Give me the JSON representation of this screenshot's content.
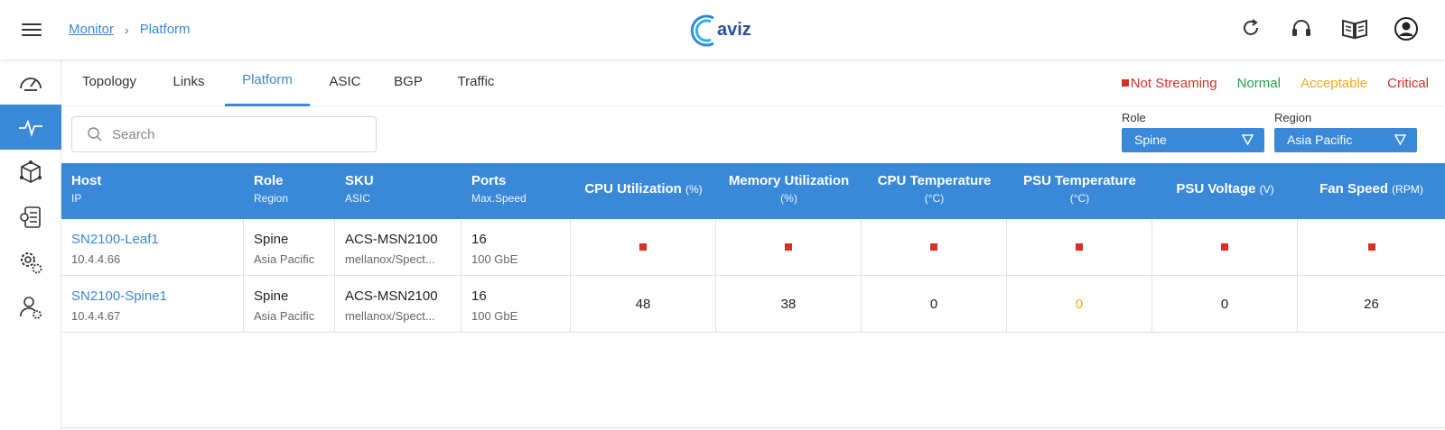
{
  "breadcrumb": {
    "root": "Monitor",
    "separator": "›",
    "current": "Platform"
  },
  "logo": {
    "text": "aviz"
  },
  "header_icons": [
    "refresh-icon",
    "headset-icon",
    "book-icon",
    "user-account-icon"
  ],
  "sidebar_icons": [
    "dashboard-gauge-icon",
    "monitor-pulse-icon",
    "network-cube-icon",
    "config-document-icon",
    "settings-gears-icon",
    "user-settings-icon"
  ],
  "tabs": [
    {
      "label": "Topology"
    },
    {
      "label": "Links"
    },
    {
      "label": "Platform",
      "active": true
    },
    {
      "label": "ASIC"
    },
    {
      "label": "BGP"
    },
    {
      "label": "Traffic"
    }
  ],
  "legend": {
    "not_streaming": "Not Streaming",
    "normal": "Normal",
    "acceptable": "Acceptable",
    "critical": "Critical"
  },
  "colors": {
    "accent": "#3a88d8",
    "not_streaming": "#d93025",
    "normal": "#27a04a",
    "acceptable": "#f2a91d",
    "critical": "#d93025"
  },
  "search": {
    "placeholder": "Search",
    "value": ""
  },
  "filters": {
    "role": {
      "label": "Role",
      "value": "Spine"
    },
    "region": {
      "label": "Region",
      "value": "Asia Pacific"
    }
  },
  "table": {
    "columns": [
      {
        "title": "Host",
        "sub": "IP"
      },
      {
        "title": "Role",
        "sub": "Region"
      },
      {
        "title": "SKU",
        "sub": "ASIC"
      },
      {
        "title": "Ports",
        "sub": "Max.Speed"
      },
      {
        "title": "CPU Utilization",
        "unit": "(%)"
      },
      {
        "title": "Memory Utilization",
        "unit": "(%)"
      },
      {
        "title": "CPU Temperature",
        "unit": "(°C)"
      },
      {
        "title": "PSU Temperature",
        "unit": "(°C)"
      },
      {
        "title": "PSU Voltage",
        "unit": "(V)"
      },
      {
        "title": "Fan Speed",
        "unit": "(RPM)"
      }
    ],
    "rows": [
      {
        "host": "SN2100-Leaf1",
        "ip": "10.4.4.66",
        "role": "Spine",
        "region": "Asia Pacific",
        "sku": "ACS-MSN2100",
        "asic": "mellanox/Spect...",
        "ports": "16",
        "max_speed": "100 GbE",
        "cpu_util": null,
        "mem_util": null,
        "cpu_temp": null,
        "psu_temp": null,
        "psu_voltage": null,
        "fan_speed": null,
        "status": "not_streaming"
      },
      {
        "host": "SN2100-Spine1",
        "ip": "10.4.4.67",
        "role": "Spine",
        "region": "Asia Pacific",
        "sku": "ACS-MSN2100",
        "asic": "mellanox/Spect...",
        "ports": "16",
        "max_speed": "100 GbE",
        "cpu_util": "48",
        "mem_util": "38",
        "cpu_temp": "0",
        "psu_temp": "0",
        "psu_voltage": "0",
        "fan_speed": "26",
        "psu_temp_state": "acceptable"
      }
    ]
  }
}
